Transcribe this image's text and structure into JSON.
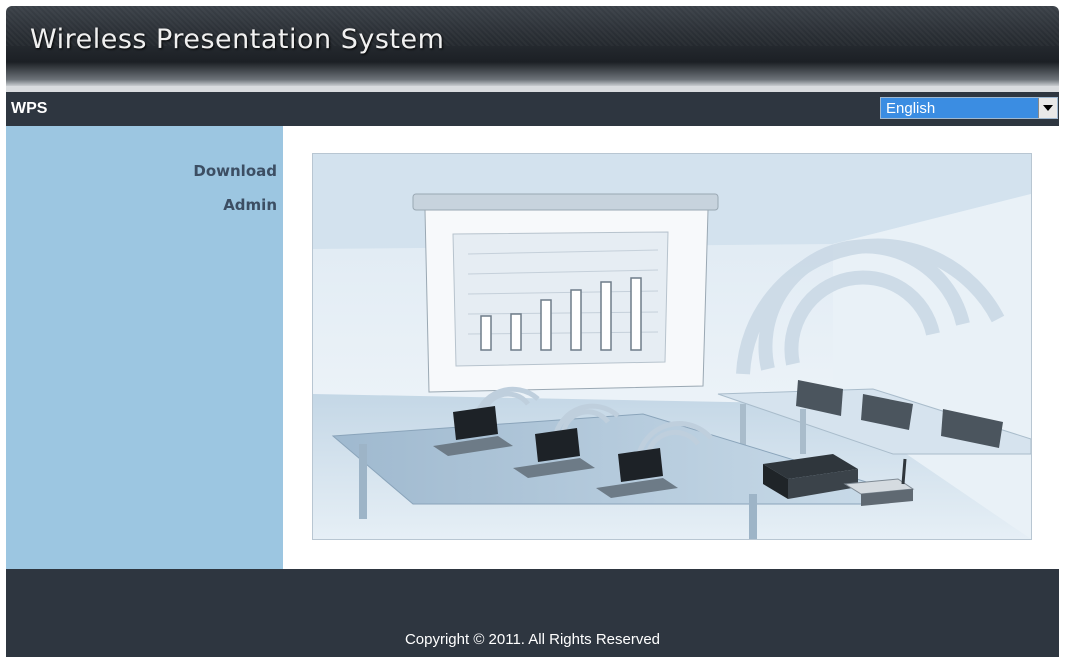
{
  "banner": {
    "title": "Wireless Presentation System"
  },
  "navbar": {
    "title": "WPS",
    "language": {
      "selected": "English"
    }
  },
  "sidebar": {
    "items": [
      {
        "label": "Download"
      },
      {
        "label": "Admin"
      }
    ]
  },
  "illustration": {
    "icon": "presentation-room-illustration"
  },
  "footer": {
    "copyright": "Copyright © 2011. All Rights Reserved"
  }
}
